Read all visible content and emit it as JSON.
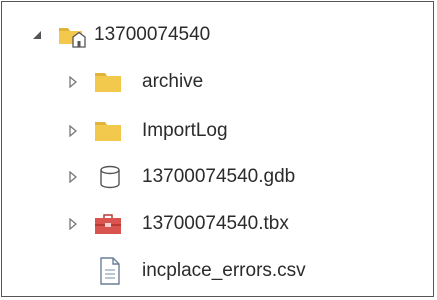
{
  "tree": {
    "root": {
      "label": "13700074540",
      "icon": "home-folder-icon",
      "expanded": true
    },
    "children": [
      {
        "label": "archive",
        "icon": "folder-icon",
        "expandable": true
      },
      {
        "label": "ImportLog",
        "icon": "folder-icon",
        "expandable": true
      },
      {
        "label": "13700074540.gdb",
        "icon": "geodatabase-icon",
        "expandable": true
      },
      {
        "label": "13700074540.tbx",
        "icon": "toolbox-icon",
        "expandable": true
      },
      {
        "label": "incplace_errors.csv",
        "icon": "csv-file-icon",
        "expandable": false
      }
    ]
  },
  "colors": {
    "folder": "#f2c94c",
    "folder_tab": "#e0b43a",
    "toolbox": "#d9534f",
    "text": "#2b2b2b",
    "border": "#555555"
  }
}
